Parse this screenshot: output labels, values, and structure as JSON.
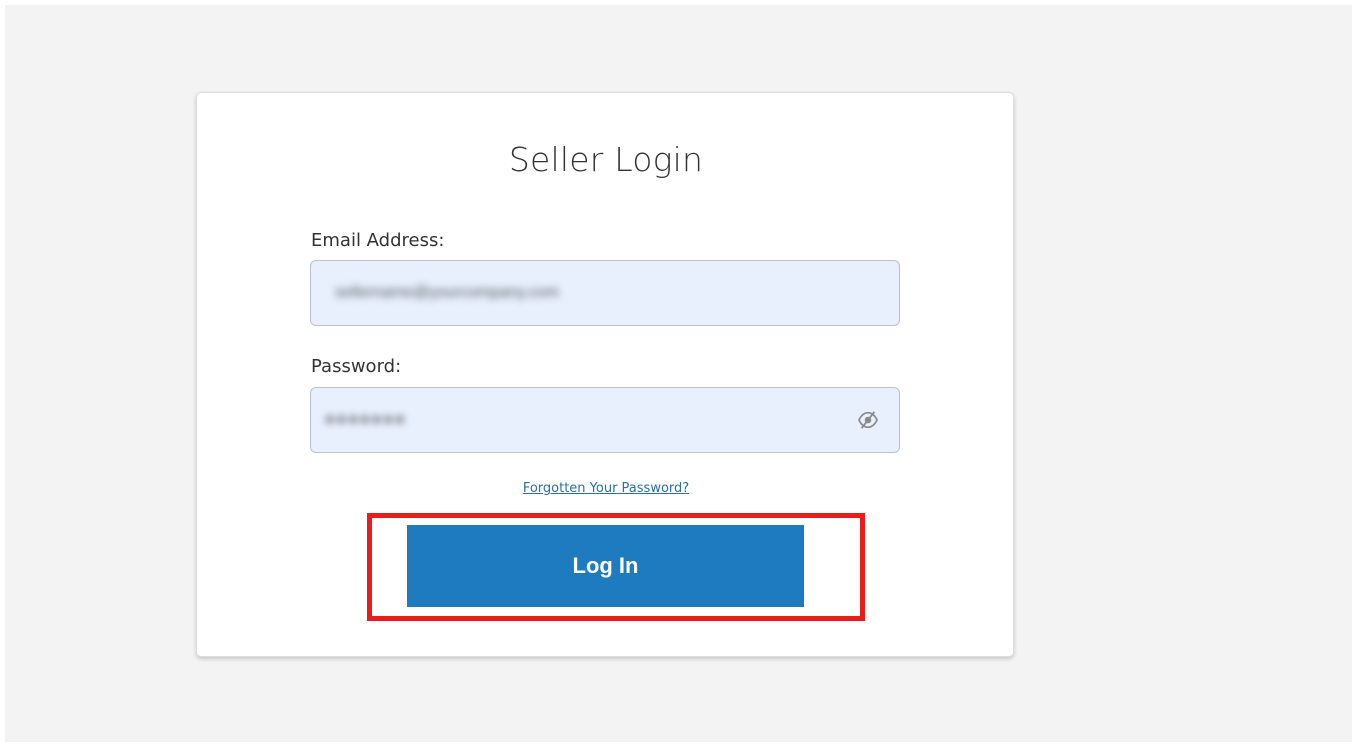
{
  "login": {
    "title": "Seller Login",
    "email_label": "Email Address:",
    "email_value": "sellername@yourcompany.com",
    "password_label": "Password:",
    "password_value": "●●●●●●●",
    "password_toggle_icon": "eye-slash-icon",
    "forgot_link": "Forgotten Your Password?",
    "submit_label": "Log In"
  },
  "colors": {
    "backdrop": "#f3f3f3",
    "field_fill": "#e8f0fe",
    "button": "#1f7bbf",
    "link": "#2a6fa8",
    "highlight": "#ec1c1c"
  }
}
